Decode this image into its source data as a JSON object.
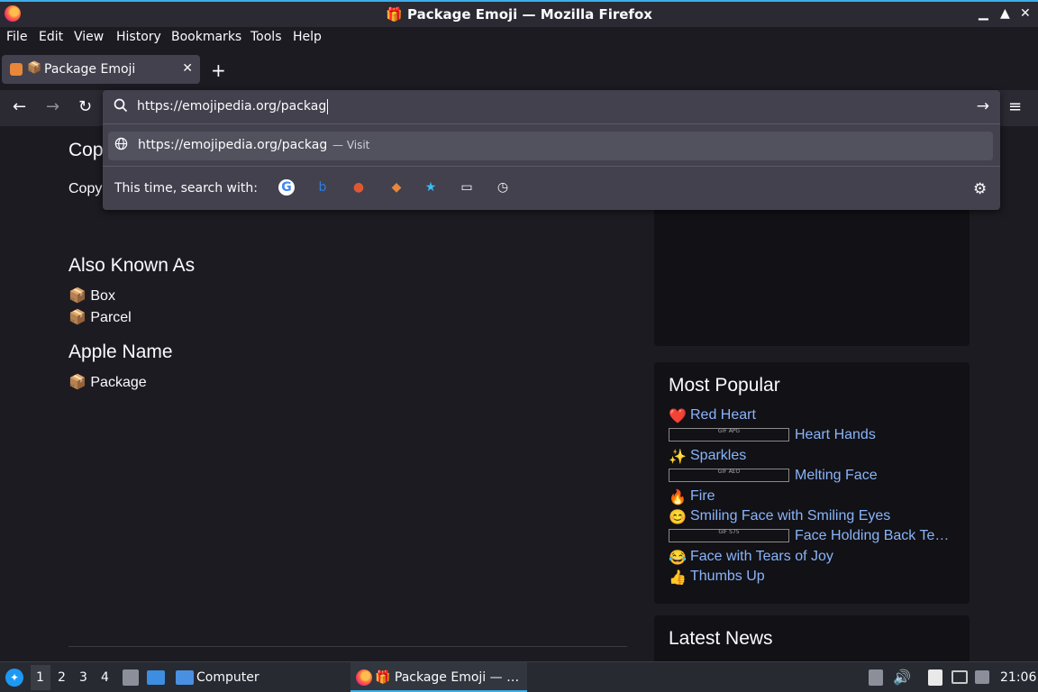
{
  "window": {
    "title": "🎁 Package Emoji — Mozilla Firefox",
    "min_icon": "▁",
    "max_icon": "▲",
    "close_icon": "✕"
  },
  "menu": [
    "File",
    "Edit",
    "View",
    "History",
    "Bookmarks",
    "Tools",
    "Help"
  ],
  "tab": {
    "emoji": "📦",
    "label": "Package Emoji",
    "close": "✕",
    "new_tab": "+"
  },
  "nav": {
    "back": "←",
    "forward": "→",
    "reload": "↻",
    "menu": "≡"
  },
  "urlbar": {
    "search_icon": "🔍",
    "url": "https://emojipedia.org/packag",
    "go_icon": "→",
    "suggestion_icon": "🌐",
    "suggestion_url": "https://emojipedia.org/packag",
    "suggestion_action": "— Visit",
    "search_with_label": "This time, search with:",
    "engines": [
      {
        "name": "google-icon",
        "glyph": "G",
        "color": "#4285f4"
      },
      {
        "name": "bing-icon",
        "glyph": "b",
        "color": "#2f7de1"
      },
      {
        "name": "duckduckgo-icon",
        "glyph": "●",
        "color": "#de5833"
      },
      {
        "name": "addon-engine-icon",
        "glyph": "◆",
        "color": "#e8863a"
      },
      {
        "name": "bookmarks-icon",
        "glyph": "★",
        "color": "#3dbdf5"
      },
      {
        "name": "tabs-icon",
        "glyph": "▭",
        "color": "#fbfbfe"
      },
      {
        "name": "history-icon",
        "glyph": "◷",
        "color": "#fbfbfe"
      }
    ],
    "settings_icon": "⚙"
  },
  "page": {
    "copy_heading": "Cop",
    "copy_text": "Copy",
    "also_known_as": {
      "heading": "Also Known As",
      "items": [
        "📦 Box",
        "📦 Parcel"
      ]
    },
    "apple_name": {
      "heading": "Apple Name",
      "items": [
        "📦 Package"
      ]
    }
  },
  "sidebar": {
    "most_popular": {
      "heading": "Most Popular",
      "items": [
        {
          "emoji": "❤️",
          "label": "Red Heart",
          "gif": false
        },
        {
          "emoji": "",
          "label": "Heart Hands",
          "gif": true,
          "gif_text": "GIF\nAPG"
        },
        {
          "emoji": "✨",
          "label": "Sparkles",
          "gif": false
        },
        {
          "emoji": "",
          "label": "Melting Face",
          "gif": true,
          "gif_text": "GIF\nAEO"
        },
        {
          "emoji": "🔥",
          "label": "Fire",
          "gif": false
        },
        {
          "emoji": "😊",
          "label": "Smiling Face with Smiling Eyes",
          "gif": false
        },
        {
          "emoji": "",
          "label": "Face Holding Back Te…",
          "gif": true,
          "gif_text": "GIF\nS75"
        },
        {
          "emoji": "😂",
          "label": "Face with Tears of Joy",
          "gif": false
        },
        {
          "emoji": "👍",
          "label": "Thumbs Up",
          "gif": false
        }
      ]
    },
    "latest_news": {
      "heading": "Latest News"
    }
  },
  "taskbar": {
    "start_icon": "🐧",
    "workspaces": [
      "1",
      "2",
      "3",
      "4"
    ],
    "computer_label": "Computer",
    "firefox_task": "🎁 Package Emoji — …",
    "clock": "21:06"
  }
}
